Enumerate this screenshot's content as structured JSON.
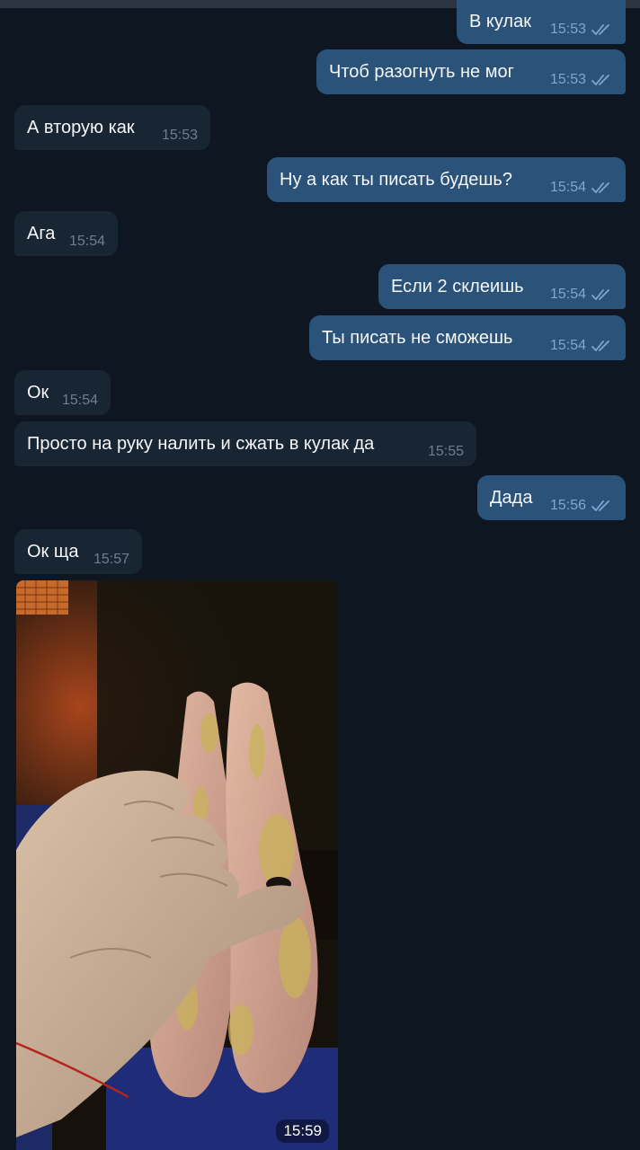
{
  "messages": [
    {
      "dir": "out",
      "text": "В кулак",
      "time": "15:53",
      "read": true
    },
    {
      "dir": "out",
      "text": "Чтоб разогнуть не мог",
      "time": "15:53",
      "read": true
    },
    {
      "dir": "in",
      "text": "А вторую как",
      "time": "15:53"
    },
    {
      "dir": "out",
      "text": "Ну а как ты писать будешь?",
      "time": "15:54",
      "read": true
    },
    {
      "dir": "in",
      "text": "Ага",
      "time": "15:54"
    },
    {
      "dir": "out",
      "text": "Если 2 склеишь",
      "time": "15:54",
      "read": true
    },
    {
      "dir": "out",
      "text": "Ты писать не сможешь",
      "time": "15:54",
      "read": true
    },
    {
      "dir": "in",
      "text": "Ок",
      "time": "15:54"
    },
    {
      "dir": "in",
      "text": "Просто на руку налить и сжать в кулак да",
      "time": "15:55"
    },
    {
      "dir": "out",
      "text": "Дада",
      "time": "15:56",
      "read": true
    },
    {
      "dir": "in",
      "text": "Ок ща",
      "time": "15:57"
    }
  ],
  "photo": {
    "time": "15:59",
    "icon": "photo-message"
  },
  "colors": {
    "background": "#0e1621",
    "outgoing_bubble": "#2b5278",
    "incoming_bubble": "#182533",
    "read_check": "#7da8d3"
  }
}
